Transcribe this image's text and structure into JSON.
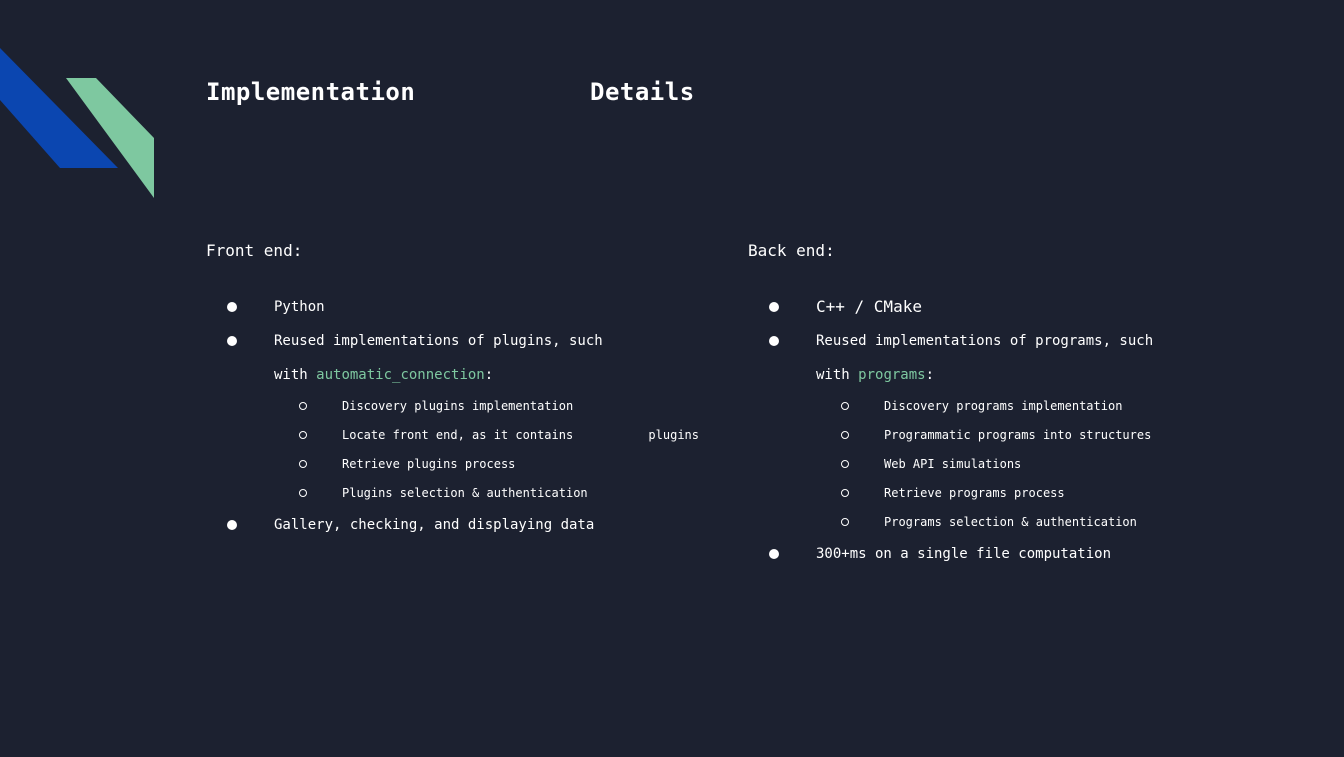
{
  "title": {
    "left": "Implementation",
    "right": "Details"
  },
  "colors": {
    "background": "#1c2130",
    "accent_blue": "#0b46b0",
    "accent_green": "#7ec8a0",
    "link": "#7ec8a0",
    "text": "#ffffff"
  },
  "columns": [
    {
      "header": "Front end:",
      "items": [
        {
          "text": "Python"
        },
        {
          "line1": "Reused implementations of plugins, such",
          "line2_prefix": "with ",
          "line2_link": "automatic_connection",
          "line2_suffix": ":",
          "sub": [
            {
              "text": "Discovery plugins implementation"
            },
            {
              "line1": "Locate front end, as it contains",
              "line2": "plugins"
            },
            {
              "text": "Retrieve plugins process"
            },
            {
              "text": "Plugins selection & authentication"
            }
          ]
        },
        {
          "text": "Gallery, checking, and displaying data"
        }
      ]
    },
    {
      "header": "Back end:",
      "items": [
        {
          "text": "C++ / CMake"
        },
        {
          "line1": "Reused implementations of programs, such",
          "line2_prefix": "with ",
          "line2_link": "programs",
          "line2_suffix": ":",
          "sub": [
            {
              "text": "Discovery programs implementation"
            },
            {
              "text": "Programmatic programs into structures"
            },
            {
              "text": "Web API simulations"
            },
            {
              "text": "Retrieve programs process"
            },
            {
              "text": "Programs selection & authentication"
            }
          ]
        },
        {
          "text": "300+ms on a single file computation"
        }
      ]
    }
  ]
}
